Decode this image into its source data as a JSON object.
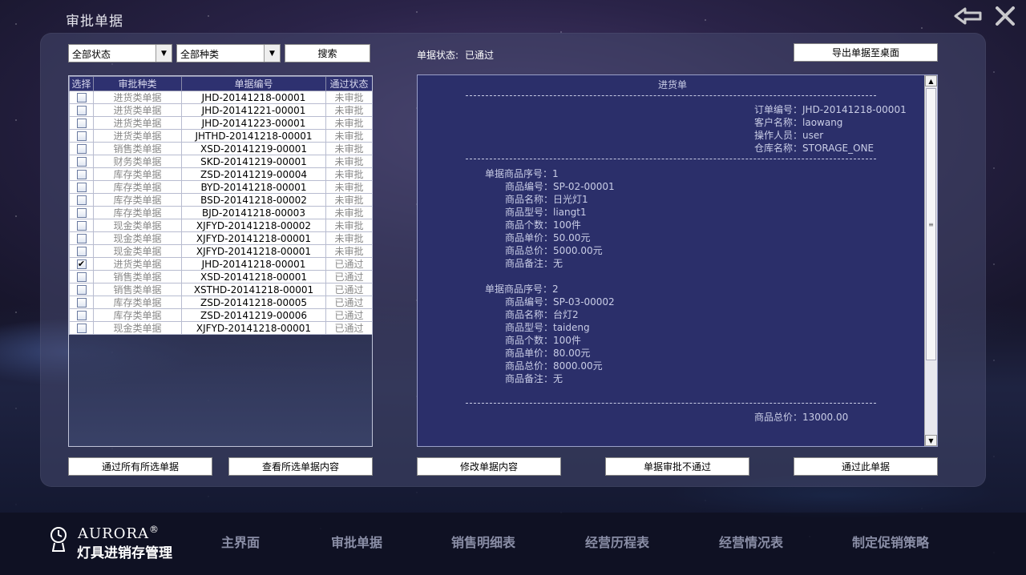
{
  "window": {
    "title": "审批单据"
  },
  "filters": {
    "status_select": "全部状态",
    "kind_select": "全部种类",
    "search_label": "搜索"
  },
  "table": {
    "headers": [
      "选择",
      "审批种类",
      "单据编号",
      "通过状态"
    ],
    "rows": [
      {
        "checked": false,
        "kind": "进货类单据",
        "id": "JHD-20141218-00001",
        "status": "未审批"
      },
      {
        "checked": false,
        "kind": "进货类单据",
        "id": "JHD-20141221-00001",
        "status": "未审批"
      },
      {
        "checked": false,
        "kind": "进货类单据",
        "id": "JHD-20141223-00001",
        "status": "未审批"
      },
      {
        "checked": false,
        "kind": "进货类单据",
        "id": "JHTHD-20141218-00001",
        "status": "未审批"
      },
      {
        "checked": false,
        "kind": "销售类单据",
        "id": "XSD-20141219-00001",
        "status": "未审批"
      },
      {
        "checked": false,
        "kind": "财务类单据",
        "id": "SKD-20141219-00001",
        "status": "未审批"
      },
      {
        "checked": false,
        "kind": "库存类单据",
        "id": "ZSD-20141219-00004",
        "status": "未审批"
      },
      {
        "checked": false,
        "kind": "库存类单据",
        "id": "BYD-20141218-00001",
        "status": "未审批"
      },
      {
        "checked": false,
        "kind": "库存类单据",
        "id": "BSD-20141218-00002",
        "status": "未审批"
      },
      {
        "checked": false,
        "kind": "库存类单据",
        "id": "BJD-20141218-00003",
        "status": "未审批"
      },
      {
        "checked": false,
        "kind": "现金类单据",
        "id": "XJFYD-20141218-00002",
        "status": "未审批"
      },
      {
        "checked": false,
        "kind": "现金类单据",
        "id": "XJFYD-20141218-00001",
        "status": "未审批"
      },
      {
        "checked": false,
        "kind": "现金类单据",
        "id": "XJFYD-20141218-00001",
        "status": "未审批"
      },
      {
        "checked": true,
        "kind": "进货类单据",
        "id": "JHD-20141218-00001",
        "status": "已通过"
      },
      {
        "checked": false,
        "kind": "销售类单据",
        "id": "XSD-20141218-00001",
        "status": "已通过"
      },
      {
        "checked": false,
        "kind": "销售类单据",
        "id": "XSTHD-20141218-00001",
        "status": "已通过"
      },
      {
        "checked": false,
        "kind": "库存类单据",
        "id": "ZSD-20141218-00005",
        "status": "已通过"
      },
      {
        "checked": false,
        "kind": "库存类单据",
        "id": "ZSD-20141219-00006",
        "status": "已通过"
      },
      {
        "checked": false,
        "kind": "现金类单据",
        "id": "XJFYD-20141218-00001",
        "status": "已通过"
      }
    ]
  },
  "doc_status": {
    "label": "单据状态:",
    "value": "已通过"
  },
  "export_label": "导出单据至桌面",
  "detail": {
    "title": "进货单",
    "order_no": "订单编号：JHD-20141218-00001",
    "customer": "客户名称：laowang",
    "operator": "操作人员：user",
    "warehouse": "仓库名称：STORAGE_ONE",
    "items": [
      {
        "seq": "单据商品序号：1",
        "code": "商品编号：SP-02-00001",
        "name": "商品名称：日光灯1",
        "model": "商品型号：liangt1",
        "count": "商品个数：100件",
        "price": "商品单价：50.00元",
        "total": "商品总价：5000.00元",
        "note": "商品备注：无"
      },
      {
        "seq": "单据商品序号：2",
        "code": "商品编号：SP-03-00002",
        "name": "商品名称：台灯2",
        "model": "商品型号：taideng",
        "count": "商品个数：100件",
        "price": "商品单价：80.00元",
        "total": "商品总价：8000.00元",
        "note": "商品备注：无"
      }
    ],
    "grand_total": "商品总价：13000.00"
  },
  "actions": {
    "approve_selected": "通过所有所选单据",
    "view_selected": "查看所选单据内容",
    "modify": "修改单据内容",
    "reject": "单据审批不通过",
    "approve_this": "通过此单据"
  },
  "brand": {
    "name": "AURORA",
    "mark": "®",
    "subtitle": "灯具进销存管理"
  },
  "nav": [
    "主界面",
    "审批单据",
    "销售明细表",
    "经营历程表",
    "经营情况表",
    "制定促销策略"
  ]
}
